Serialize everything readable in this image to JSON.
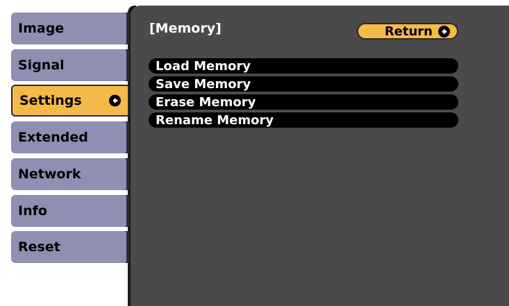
{
  "sidebar": {
    "items": [
      {
        "label": "Image"
      },
      {
        "label": "Signal"
      },
      {
        "label": "Settings"
      },
      {
        "label": "Extended"
      },
      {
        "label": "Network"
      },
      {
        "label": "Info"
      },
      {
        "label": "Reset"
      }
    ],
    "active_index": 2
  },
  "panel": {
    "title": "[Memory]",
    "return_label": "Return",
    "options": [
      {
        "label": "Load Memory"
      },
      {
        "label": "Save Memory"
      },
      {
        "label": "Erase Memory"
      },
      {
        "label": "Rename Memory"
      }
    ]
  },
  "icons": {
    "enter": "enter-icon"
  },
  "colors": {
    "menu_inactive": "#8f8fb3",
    "menu_active": "#f5b94a",
    "panel_bg": "#4a4a4a",
    "option_bg": "#000000"
  }
}
